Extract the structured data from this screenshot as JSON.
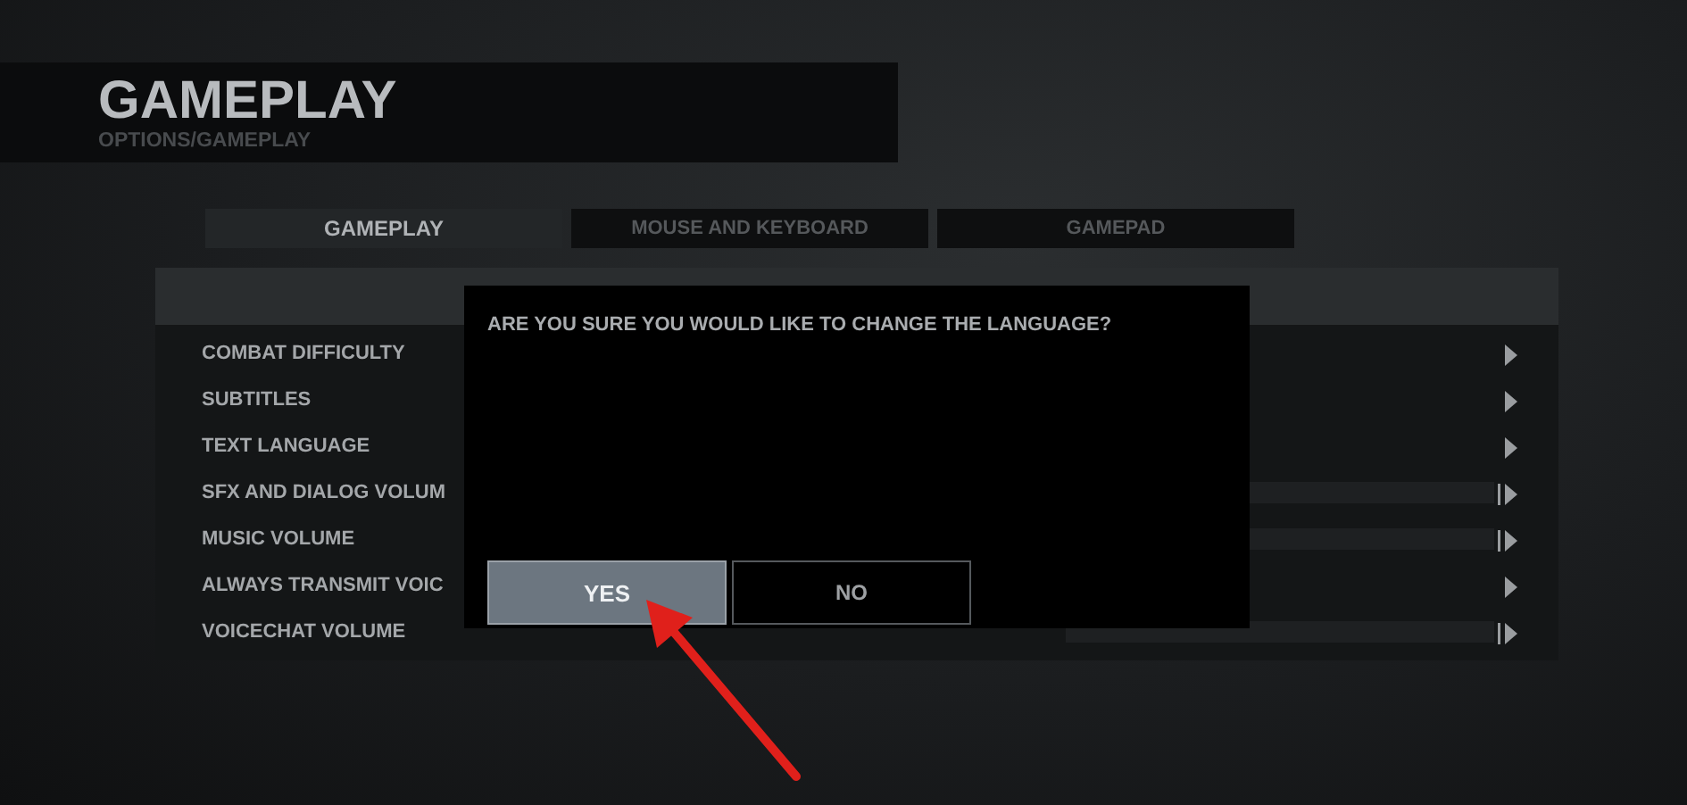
{
  "header": {
    "title": "GAMEPLAY",
    "breadcrumb": "OPTIONS/GAMEPLAY"
  },
  "tabs": [
    {
      "label": "GAMEPLAY",
      "selected": true
    },
    {
      "label": "MOUSE AND KEYBOARD",
      "selected": false
    },
    {
      "label": "GAMEPAD",
      "selected": false
    }
  ],
  "settings": [
    {
      "label": "COMBAT DIFFICULTY",
      "kind": "choice"
    },
    {
      "label": "SUBTITLES",
      "kind": "choice"
    },
    {
      "label": "TEXT LANGUAGE",
      "kind": "choice"
    },
    {
      "label": "SFX AND DIALOG VOLUM",
      "kind": "slider"
    },
    {
      "label": "MUSIC VOLUME",
      "kind": "slider"
    },
    {
      "label": "ALWAYS TRANSMIT VOIC",
      "kind": "choice"
    },
    {
      "label": "VOICECHAT VOLUME",
      "kind": "slider"
    }
  ],
  "dialog": {
    "message": "ARE YOU SURE YOU WOULD LIKE TO CHANGE THE LANGUAGE?",
    "buttons": [
      {
        "label": "YES",
        "selected": true
      },
      {
        "label": "NO",
        "selected": false
      }
    ]
  }
}
